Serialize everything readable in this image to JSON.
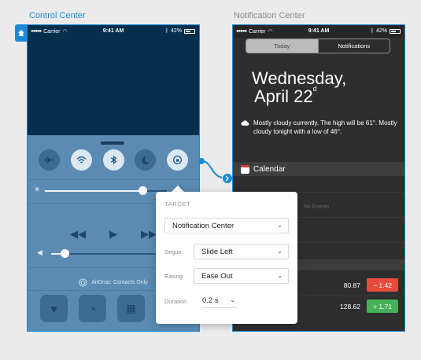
{
  "labels": {
    "control_center": "Control Center",
    "notification_center": "Notification Center"
  },
  "status_bar": {
    "carrier": "Carrier",
    "time": "9:41 AM",
    "battery": "42%"
  },
  "control_center": {
    "toggles": [
      {
        "icon": "airplane-icon",
        "on": false
      },
      {
        "icon": "wifi-icon",
        "on": true
      },
      {
        "icon": "bluetooth-icon",
        "on": true
      },
      {
        "icon": "moon-icon",
        "on": false
      },
      {
        "icon": "rotation-lock-icon",
        "on": true
      }
    ],
    "brightness_level": 0.8,
    "volume_level": 0.1,
    "airdrop_label": "AirDrop: Contacts Only",
    "shortcuts": [
      "flashlight-icon",
      "timer-icon",
      "calculator-icon",
      "camera-icon"
    ]
  },
  "notification_center": {
    "tabs": [
      "Today",
      "Notifications"
    ],
    "selected_tab": "Notifications",
    "weekday": "Wednesday,",
    "date": "April 22",
    "date_suffix": "d",
    "weather": "Mostly cloudy currently. The high will be 61°. Mostly cloudy tonight with a low of 46°.",
    "calendar_title": "Calendar",
    "no_events": "No Events",
    "stocks": [
      {
        "price": "80.87",
        "change": "− 1.42",
        "direction": "down"
      },
      {
        "price": "128.62",
        "change": "+ 1.71",
        "direction": "up"
      }
    ]
  },
  "popover": {
    "heading": "TARGET",
    "target_value": "Notification Center",
    "segue_label": "Segue",
    "segue_value": "Slide Left",
    "easing_label": "Easing",
    "easing_value": "Ease Out",
    "duration_label": "Duration",
    "duration_value": "0.2 s"
  },
  "colors": {
    "accent": "#1a8ad6",
    "negative": "#e64b3c",
    "positive": "#49b05a"
  }
}
